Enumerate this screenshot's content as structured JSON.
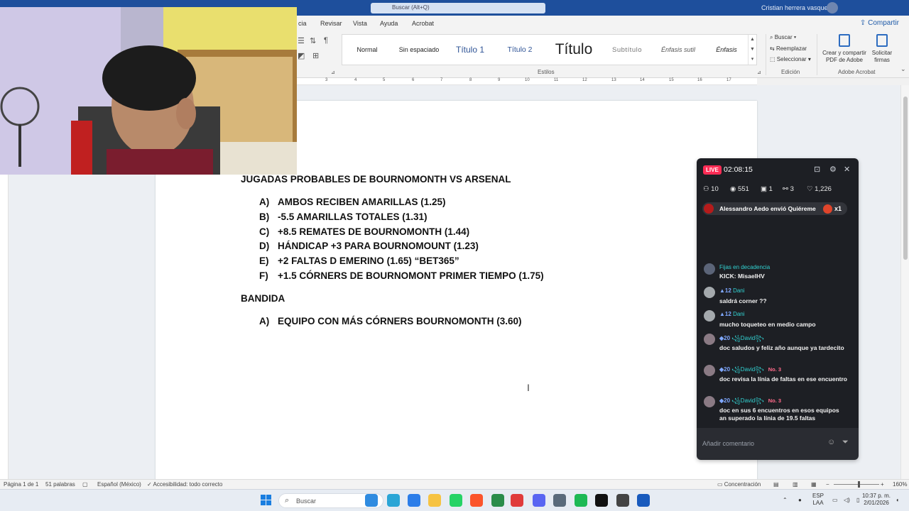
{
  "titlebar": {
    "search_placeholder": "Buscar (Alt+Q)",
    "user_name": "Cristian herrera vasquez"
  },
  "menu": {
    "tabs": [
      "cia",
      "Revisar",
      "Vista",
      "Ayuda",
      "Acrobat"
    ],
    "share_label": "Compartir"
  },
  "ribbon": {
    "styles": [
      {
        "label": "Normal"
      },
      {
        "label": "Sin espaciado"
      },
      {
        "label": "Título 1"
      },
      {
        "label": "Título 2"
      },
      {
        "label": "Título"
      },
      {
        "label": "Subtítulo"
      },
      {
        "label": "Énfasis sutil"
      },
      {
        "label": "Énfasis"
      }
    ],
    "styles_group_label": "Estilos",
    "editing": {
      "find": "Buscar",
      "replace": "Reemplazar",
      "select": "Seleccionar",
      "group_label": "Edición"
    },
    "acrobat": {
      "create_pdf": "Crear y compartir PDF de Adobe",
      "request_sign": "Solicitar firmas",
      "group_label": "Adobe Acrobat"
    }
  },
  "ruler": {
    "numbers": [
      "3",
      "4",
      "5",
      "6",
      "7",
      "8",
      "9",
      "10",
      "11",
      "12",
      "13",
      "14",
      "15",
      "16",
      "17"
    ]
  },
  "document": {
    "heading1": "JUGADAS PROBABLES DE BOURNOMONTH VS ARSENAL",
    "list1": [
      {
        "letter": "A)",
        "text": "AMBOS RECIBEN AMARILLAS (1.25)"
      },
      {
        "letter": "B)",
        "text": "-5.5 AMARILLAS TOTALES (1.31)"
      },
      {
        "letter": "C)",
        "text": "+8.5 REMATES DE BOURNOMONTH (1.44)"
      },
      {
        "letter": "D)",
        "text": "HÁNDICAP +3 PARA BOURNOMOUNT (1.23)"
      },
      {
        "letter": "E)",
        "text": "+2 FALTAS D EMERINO (1.65) “BET365”"
      },
      {
        "letter": "F)",
        "text": "+1.5 CÓRNERS DE BOURNOMONT PRIMER TIEMPO (1.75)"
      }
    ],
    "heading2": "BANDIDA",
    "list2": [
      {
        "letter": "A)",
        "text": "EQUIPO CON MÁS CÓRNERS BOURNOMONTH (3.60)"
      }
    ]
  },
  "live": {
    "badge": "LIVE",
    "time": "02:08:15",
    "stats": [
      "10",
      "551",
      "1",
      "3",
      "1,226"
    ],
    "gift": {
      "text": "Alessandro Aedo envió Quiéreme",
      "count": "x1"
    },
    "messages": [
      {
        "name": "Fijas en decadencia",
        "level": "",
        "badge": "",
        "text": "KICK: MisaelHV"
      },
      {
        "name": "Dani",
        "level": "12",
        "badge": "",
        "text": "saldrá corner ??"
      },
      {
        "name": "Dani",
        "level": "12",
        "badge": "",
        "text": "mucho toqueteo en medio campo"
      },
      {
        "name": "꧁David꧂",
        "level": "20",
        "badge": "",
        "text": "doc saludos y feliz año aunque ya tardecito"
      },
      {
        "name": "꧁David꧂",
        "level": "20",
        "badge": "No. 3",
        "text": "doc revisa la línia de faltas en ese encuentro"
      },
      {
        "name": "꧁David꧂",
        "level": "20",
        "badge": "No. 3",
        "text": "doc en sus 6 encuentros en esos equipos an superado la línia de 19.5 faltas"
      }
    ],
    "input_placeholder": "Añadir comentario"
  },
  "statusbar": {
    "page": "Página 1 de 1",
    "words": "51 palabras",
    "language": "Español (México)",
    "accessibility": "Accesibilidad: todo correcto",
    "focus": "Concentración",
    "zoom": "160%"
  },
  "taskbar": {
    "search_placeholder": "Buscar",
    "lang": "ESP",
    "lang2": "LAA",
    "time": "10:37 p. m.",
    "date": "2/01/2026",
    "app_colors": [
      "#2f8be0",
      "#2aa5d6",
      "#2b7de9",
      "#f6c343",
      "#25d366",
      "#fb542b",
      "#2a8c4a",
      "#e03b3b",
      "#5865f2",
      "#5a6a7a",
      "#1db954",
      "#111111",
      "#444444",
      "#185abd"
    ]
  },
  "colors": {
    "word_blue": "#1e4f9c",
    "live_red": "#ff2c55",
    "panel_bg": "#1d1f24"
  }
}
